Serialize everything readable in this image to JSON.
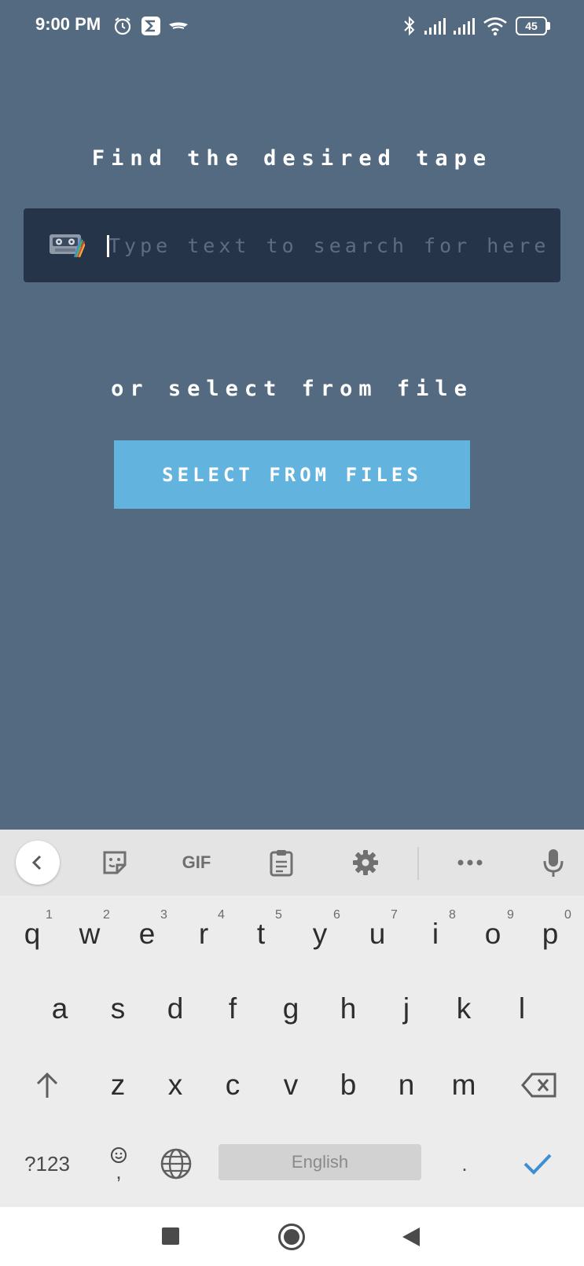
{
  "status_bar": {
    "time": "9:00 PM",
    "battery_level": "45",
    "icons": [
      "alarm-icon",
      "sigma-app-icon",
      "vpn-icon",
      "bluetooth-icon",
      "signal-icon",
      "signal-icon",
      "wifi-icon",
      "battery-icon"
    ]
  },
  "app": {
    "find_heading": "Find the desired tape",
    "search": {
      "placeholder": "Type text to search for here",
      "value": "",
      "icon": "tape-icon"
    },
    "or_heading": "or select from file",
    "select_button_label": "SELECT FROM FILES"
  },
  "keyboard": {
    "toolbar": {
      "gif_label": "GIF",
      "icons": [
        "chevron-left-icon",
        "sticker-icon",
        "gif-icon",
        "clipboard-icon",
        "gear-icon",
        "more-icon",
        "mic-icon"
      ]
    },
    "row1": [
      {
        "key": "q",
        "hint": "1"
      },
      {
        "key": "w",
        "hint": "2"
      },
      {
        "key": "e",
        "hint": "3"
      },
      {
        "key": "r",
        "hint": "4"
      },
      {
        "key": "t",
        "hint": "5"
      },
      {
        "key": "y",
        "hint": "6"
      },
      {
        "key": "u",
        "hint": "7"
      },
      {
        "key": "i",
        "hint": "8"
      },
      {
        "key": "o",
        "hint": "9"
      },
      {
        "key": "p",
        "hint": "0"
      }
    ],
    "row2": [
      "a",
      "s",
      "d",
      "f",
      "g",
      "h",
      "j",
      "k",
      "l"
    ],
    "row3": [
      "z",
      "x",
      "c",
      "v",
      "b",
      "n",
      "m"
    ],
    "symbols_label": "?123",
    "comma_label": ",",
    "space_label": "English",
    "period_label": ".",
    "accent_color": "#3d8fd1"
  },
  "nav_bar": {
    "icons": [
      "recents-icon",
      "home-icon",
      "back-icon"
    ]
  },
  "colors": {
    "background": "#546a80",
    "search_box": "#263449",
    "button": "#63b3df"
  }
}
